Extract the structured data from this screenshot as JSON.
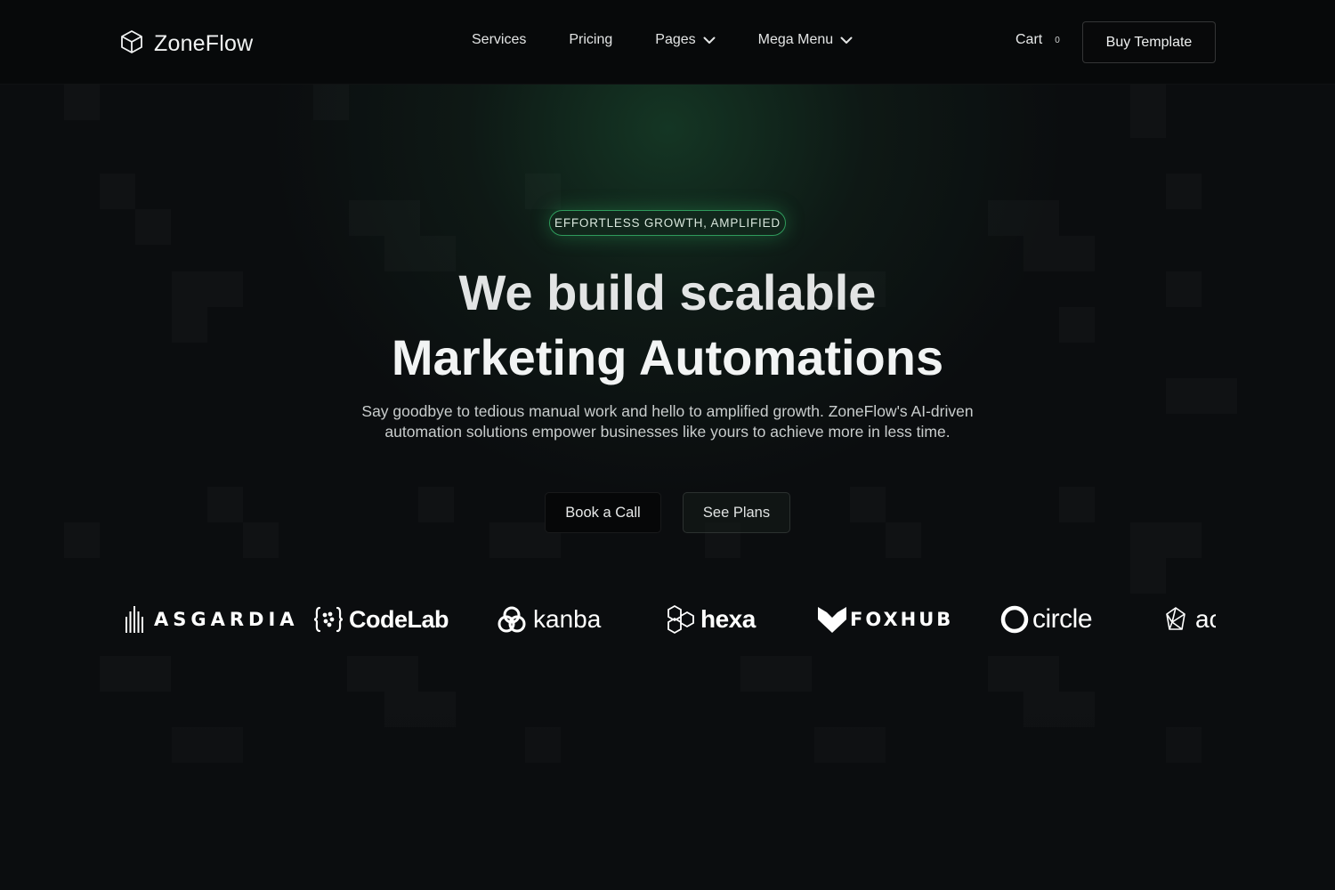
{
  "brand": {
    "name": "ZoneFlow",
    "icon": "cube-icon"
  },
  "nav": {
    "items": [
      {
        "label": "Services",
        "has_dropdown": false
      },
      {
        "label": "Pricing",
        "has_dropdown": false
      },
      {
        "label": "Pages",
        "has_dropdown": true
      },
      {
        "label": "Mega Menu",
        "has_dropdown": true
      }
    ]
  },
  "cart": {
    "label": "Cart",
    "count": "0"
  },
  "header": {
    "cta_label": "Buy Template"
  },
  "hero": {
    "badge": "EFFORTLESS GROWTH, AMPLIFIED",
    "headline_line1": "We build scalable",
    "headline_line2": "Marketing Automations",
    "subtext": "Say goodbye to tedious manual work and hello to amplified growth. ZoneFlow's AI-driven automation solutions empower businesses like yours to achieve more in less time.",
    "primary_cta": "Book a Call",
    "secondary_cta": "See Plans"
  },
  "logos": [
    {
      "name": "ASGARDIA",
      "icon": "bars-icon"
    },
    {
      "name": "CodeLab",
      "icon": "braces-icon"
    },
    {
      "name": "kanba",
      "icon": "rings-icon"
    },
    {
      "name": "hexa",
      "icon": "hexagons-icon"
    },
    {
      "name": "FOXHUB",
      "icon": "fox-icon"
    },
    {
      "name": "circle",
      "icon": "circle-icon"
    },
    {
      "name": "ac",
      "icon": "polygon-icon"
    }
  ],
  "colors": {
    "background": "#0b0d0f",
    "accent": "#2f9b5c",
    "header": "#07090a"
  }
}
